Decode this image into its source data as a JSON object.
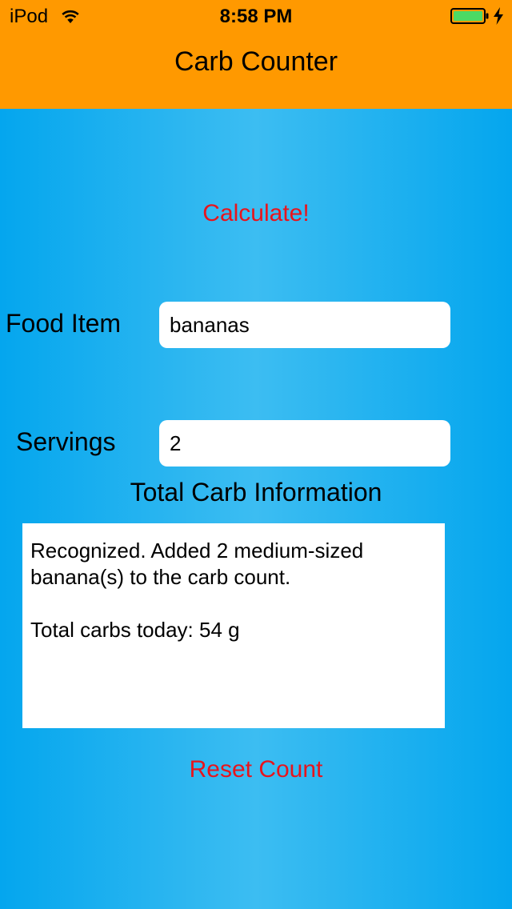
{
  "status_bar": {
    "carrier": "iPod",
    "time": "8:58 PM",
    "wifi_icon": "wifi-icon",
    "battery_icon": "battery-icon",
    "charging_icon": "charging-bolt-icon"
  },
  "header": {
    "title": "Carb Counter",
    "background_color": "#ff9900"
  },
  "actions": {
    "calculate_label": "Calculate!",
    "reset_label": "Reset Count",
    "link_color": "#e8141c"
  },
  "form": {
    "food_item_label": "Food Item",
    "food_item_value": "bananas",
    "servings_label": "Servings",
    "servings_value": "2"
  },
  "results": {
    "section_title": "Total Carb Information",
    "message_line1": "Recognized. Added 2 medium-sized",
    "message_line2": "banana(s) to the carb count.",
    "total_line": "Total carbs today: 54 g"
  },
  "colors": {
    "background": "#04a6ee",
    "battery_fill": "#4cd964"
  }
}
